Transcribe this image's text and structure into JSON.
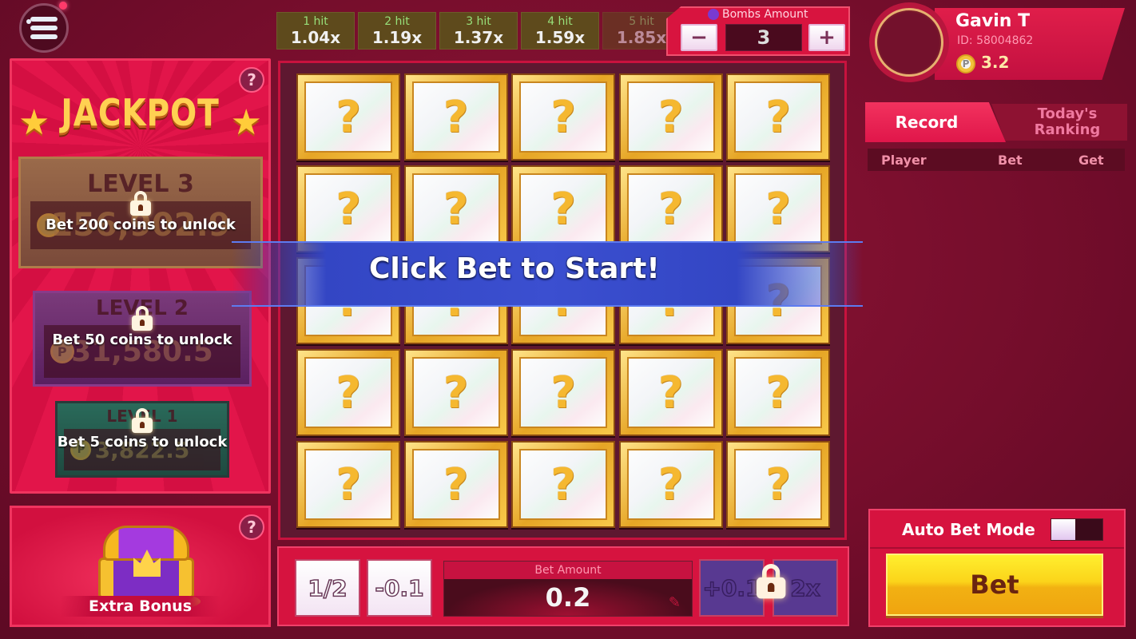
{
  "menu": {
    "icon": "hamburger-menu-icon"
  },
  "jackpot": {
    "title": "JACKPOT",
    "help": "?",
    "levels": [
      {
        "name": "LEVEL 3",
        "value": "156,902.9",
        "lock_text": "Bet 200 coins to unlock",
        "locked": true
      },
      {
        "name": "LEVEL 2",
        "value": "31,580.5",
        "lock_text": "Bet 50 coins to unlock",
        "locked": true
      },
      {
        "name": "LEVEL 1",
        "value": "3,822.5",
        "lock_text": "Bet 5 coins to unlock",
        "locked": true
      }
    ],
    "coin_symbol": "P"
  },
  "extra_bonus": {
    "label": "Extra Bonus",
    "help": "?"
  },
  "multipliers": [
    {
      "hit": "1 hit",
      "value": "1.04x"
    },
    {
      "hit": "2 hit",
      "value": "1.19x"
    },
    {
      "hit": "3 hit",
      "value": "1.37x"
    },
    {
      "hit": "4 hit",
      "value": "1.59x"
    },
    {
      "hit": "5 hit",
      "value": "1.85x"
    }
  ],
  "bombs": {
    "label": "Bombs Amount",
    "value": "3",
    "minus": "−",
    "plus": "+"
  },
  "board": {
    "rows": 5,
    "cols": 5,
    "tile_symbol": "?",
    "banner": "Click Bet to Start!"
  },
  "bet_bar": {
    "half": "1/2",
    "minus": "-0.1",
    "label": "Bet  Amount",
    "amount": "0.2",
    "plus": "+0.1",
    "double": "2x",
    "plus_double_locked": true
  },
  "profile": {
    "name": "Gavin T",
    "id": "ID: 58004862",
    "balance": "3.2",
    "coin_symbol": "P"
  },
  "tabs": {
    "record": "Record",
    "ranking": "Today's Ranking",
    "active": "record"
  },
  "records": {
    "columns": [
      "Player",
      "Bet",
      "Get"
    ],
    "rows": []
  },
  "auto_bet": {
    "label": "Auto Bet Mode",
    "enabled": false
  },
  "bet_button": "Bet",
  "colors": {
    "panel": "#d6133f",
    "background": "#7a0f2e",
    "multiplier_hit": "#98e07a",
    "banner": "#3b4fd0",
    "bet_button": "#fbd41a"
  }
}
